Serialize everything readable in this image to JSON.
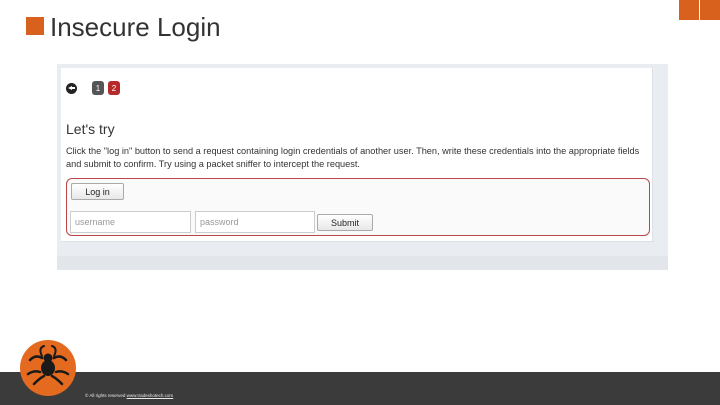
{
  "slide": {
    "title": "Insecure Login",
    "accent_color": "#d9611e"
  },
  "lesson": {
    "pages": [
      "1",
      "2"
    ],
    "current_page": "2",
    "title": "Let's try",
    "description": "Click the \"log in\" button to send a request containing login credentials of another user. Then, write these credentials into the appropriate fields and submit to confirm. Try using a packet sniffer to intercept the request.",
    "login_button": "Log in",
    "username_placeholder": "username",
    "password_placeholder": "password",
    "submit_button": "Submit",
    "box_border_color": "#b84747"
  },
  "footer": {
    "copyright": "© All rights reserved",
    "link_text": "www.tradeshotech.com"
  },
  "icons": {
    "back": "back-arrow-icon",
    "logo": "spider-logo-icon"
  }
}
